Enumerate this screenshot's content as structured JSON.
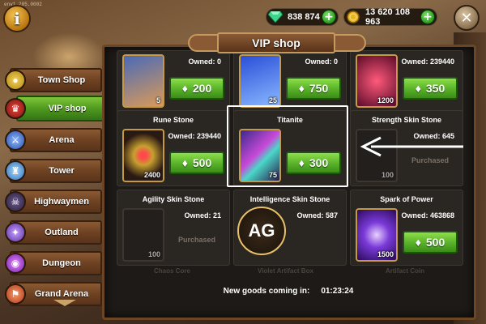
{
  "version": "env1.205.0002",
  "top_bar": {
    "gems": "838 874",
    "gold": "13 620 108 963",
    "colors": {
      "gem": "#3ed68a",
      "gold": "#e8b423",
      "plus": "#2c9a1f"
    }
  },
  "sidebar": {
    "items": [
      {
        "label": "Town Shop",
        "icon": "coin-stack-icon",
        "active": false
      },
      {
        "label": "VIP shop",
        "icon": "vip-crown-icon",
        "active": true
      },
      {
        "label": "Arena",
        "icon": "sword-icon",
        "active": false
      },
      {
        "label": "Tower",
        "icon": "tower-icon",
        "active": false
      },
      {
        "label": "Highwaymen",
        "icon": "bandit-mask-icon",
        "active": false
      },
      {
        "label": "Outland",
        "icon": "star-portal-icon",
        "active": false
      },
      {
        "label": "Dungeon",
        "icon": "purple-orb-icon",
        "active": false
      },
      {
        "label": "Grand Arena",
        "icon": "grand-arena-icon",
        "active": false
      }
    ]
  },
  "panel": {
    "title": "VIP shop",
    "cards": [
      {
        "name": "",
        "owned": "Owned: 0",
        "count": "5",
        "price": "200",
        "status": "buy",
        "icon": "hero-portrait-icon"
      },
      {
        "name": "",
        "owned": "Owned: 0",
        "count": "25",
        "price": "750",
        "status": "buy",
        "icon": "blue-chest-icon"
      },
      {
        "name": "",
        "owned": "Owned: 239440",
        "count": "1200",
        "price": "350",
        "status": "buy",
        "icon": "red-rune-icon"
      },
      {
        "name": "Rune Stone",
        "owned": "Owned: 239440",
        "count": "2400",
        "price": "500",
        "status": "buy",
        "icon": "rune-stone-icon"
      },
      {
        "name": "Titanite",
        "owned": "",
        "count": "75",
        "price": "300",
        "status": "buy",
        "icon": "titanite-crystal-icon"
      },
      {
        "name": "Strength Skin Stone",
        "owned": "Owned: 645",
        "count": "100",
        "price": "",
        "status": "Purchased",
        "icon": "strength-skin-stone-icon"
      },
      {
        "name": "Agility Skin Stone",
        "owned": "Owned: 21",
        "count": "100",
        "price": "",
        "status": "Purchased",
        "icon": "agility-skin-stone-icon"
      },
      {
        "name": "Intelligence Skin Stone",
        "owned": "Owned: 587",
        "count": "",
        "price": "",
        "status": "",
        "icon": "ag-watermark-icon"
      },
      {
        "name": "Spark of Power",
        "owned": "Owned: 463868",
        "count": "1500",
        "price": "500",
        "status": "buy",
        "icon": "spark-of-power-icon"
      }
    ],
    "ghost_labels": [
      "Chaos Core",
      "Violet Artifact Box",
      "Artifact Coin"
    ]
  },
  "footer": {
    "label": "New goods coming in:",
    "timer": "01:23:24"
  },
  "watermark": "AG"
}
